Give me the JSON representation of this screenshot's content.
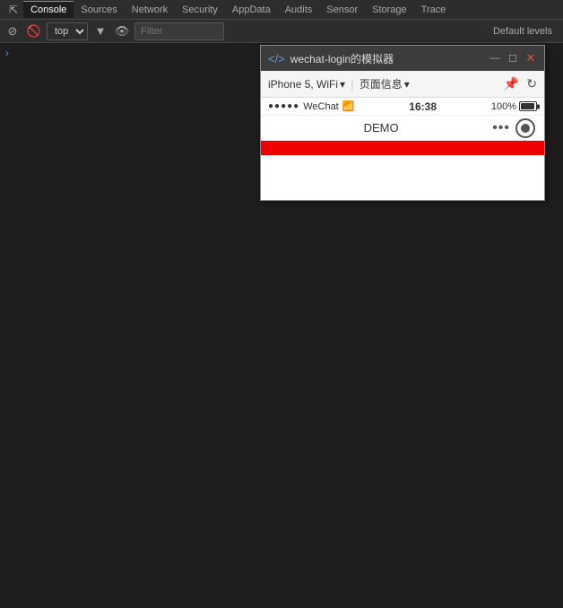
{
  "tabs": {
    "items": [
      {
        "label": "☰",
        "active": false
      },
      {
        "label": "Console",
        "active": true
      },
      {
        "label": "Sources",
        "active": false
      },
      {
        "label": "Network",
        "active": false
      },
      {
        "label": "Security",
        "active": false
      },
      {
        "label": "AppData",
        "active": false
      },
      {
        "label": "Audits",
        "active": false
      },
      {
        "label": "Sensor",
        "active": false
      },
      {
        "label": "Storage",
        "active": false
      },
      {
        "label": "Trace",
        "active": false
      }
    ]
  },
  "toolbar": {
    "top_select": "top",
    "filter_placeholder": "Filter",
    "default_levels": "Default levels",
    "block_icon": "🚫",
    "clear_icon": "⊘"
  },
  "simulator": {
    "title": "wechat-login的模拟器",
    "device": "iPhone 5, WiFi",
    "page_info": "页面信息",
    "time": "16:38",
    "battery_pct": "100%",
    "signal_dots": "●●●●●",
    "carrier": "WeChat",
    "wifi_icon": "WiFi",
    "app_title": "DEMO",
    "nav_dots": "•••"
  },
  "console_arrow": "›"
}
